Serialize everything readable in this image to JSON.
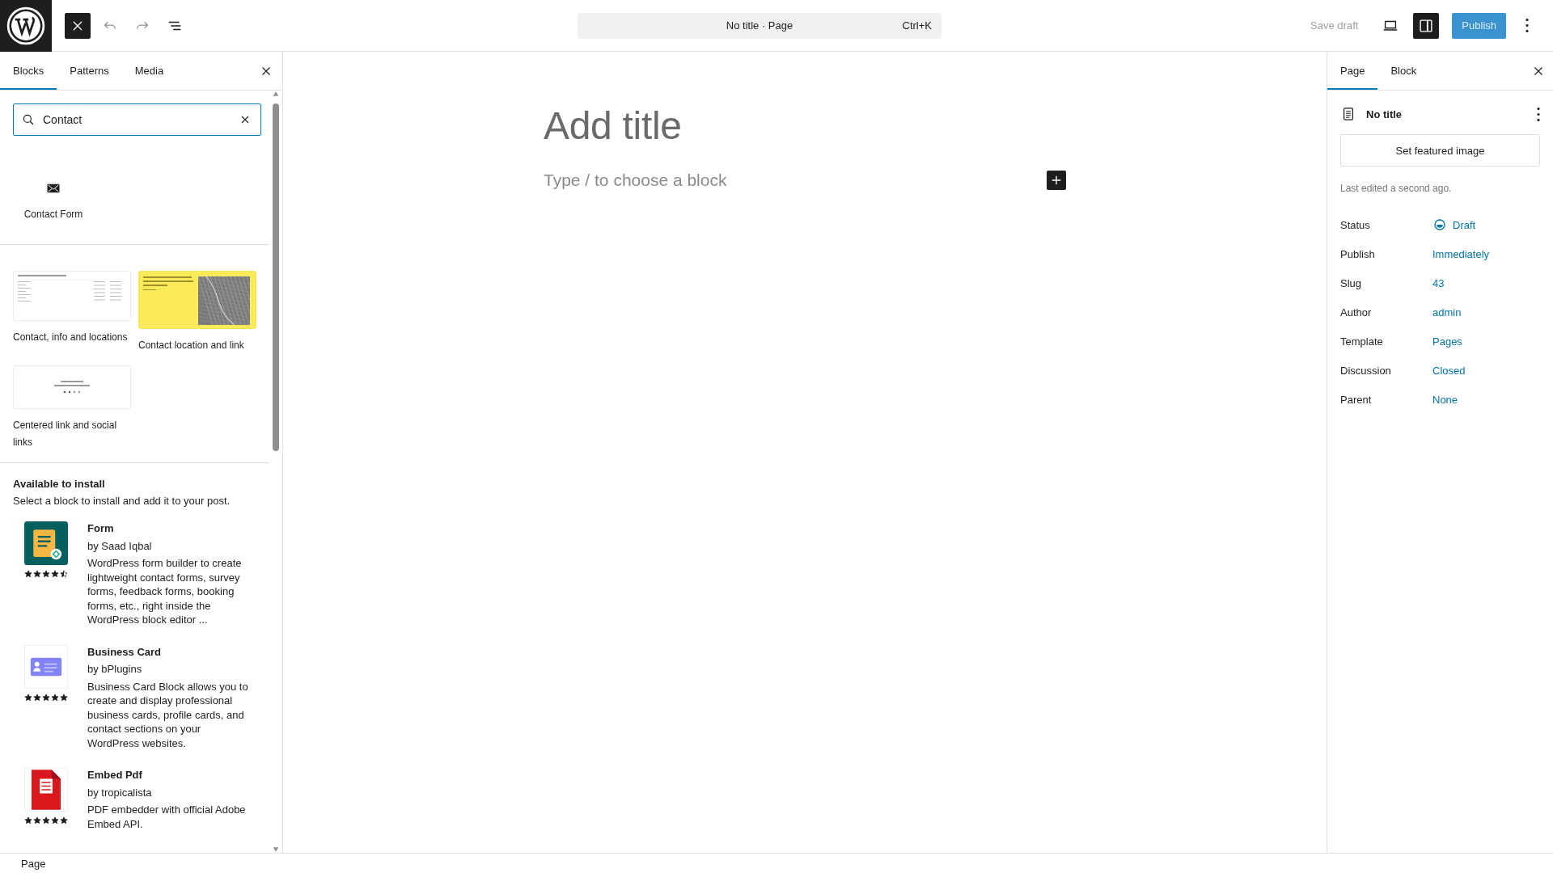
{
  "topbar": {
    "inserter_open": true,
    "document_bar": {
      "title": "No title · Page",
      "shortcut": "Ctrl+K"
    },
    "save_draft": "Save draft",
    "settings_open": true,
    "publish": "Publish"
  },
  "inserter": {
    "tabs": [
      {
        "label": "Blocks",
        "selected": true
      },
      {
        "label": "Patterns",
        "selected": false
      },
      {
        "label": "Media",
        "selected": false
      }
    ],
    "search": {
      "value": "Contact"
    },
    "blocks": [
      {
        "label": "Contact Form"
      }
    ],
    "patterns": [
      {
        "kind": "table",
        "label": "Contact, info and locations"
      },
      {
        "kind": "map",
        "label": "Contact location and link"
      },
      {
        "kind": "centered",
        "label": "Centered link and social links"
      }
    ],
    "install": {
      "heading": "Available to install",
      "description": "Select a block to install and add it to your post.",
      "plugins": [
        {
          "kind": "form",
          "name": "Form",
          "author": "by Saad Iqbal",
          "description": "WordPress form builder to create lightweight contact forms, survey forms, feedback forms, booking forms, etc., right inside the WordPress block editor ...",
          "stars": 4.5
        },
        {
          "kind": "card",
          "name": "Business Card",
          "author": "by bPlugins",
          "description": "Business Card Block allows you to create and display professional business cards, profile cards, and contact sections on your WordPress websites.",
          "stars": 5
        },
        {
          "kind": "pdf",
          "name": "Embed Pdf",
          "author": "by tropicalista",
          "description": "PDF embedder with official Adobe Embed API.",
          "stars": 5
        }
      ]
    }
  },
  "editor": {
    "title_placeholder": "Add title",
    "block_placeholder": "Type / to choose a block"
  },
  "settings": {
    "tabs": [
      {
        "label": "Page",
        "selected": true
      },
      {
        "label": "Block",
        "selected": false
      }
    ],
    "doc_title": "No title",
    "featured_button": "Set featured image",
    "last_edited": "Last edited a second ago.",
    "fields": [
      {
        "kind": "status",
        "label": "Status",
        "value": "Draft"
      },
      {
        "kind": "link",
        "label": "Publish",
        "value": "Immediately"
      },
      {
        "kind": "link",
        "label": "Slug",
        "value": "43"
      },
      {
        "kind": "link",
        "label": "Author",
        "value": "admin"
      },
      {
        "kind": "link",
        "label": "Template",
        "value": "Pages"
      },
      {
        "kind": "link",
        "label": "Discussion",
        "value": "Closed"
      },
      {
        "kind": "link",
        "label": "Parent",
        "value": "None"
      }
    ]
  },
  "status_bar": {
    "breadcrumb": "Page"
  }
}
